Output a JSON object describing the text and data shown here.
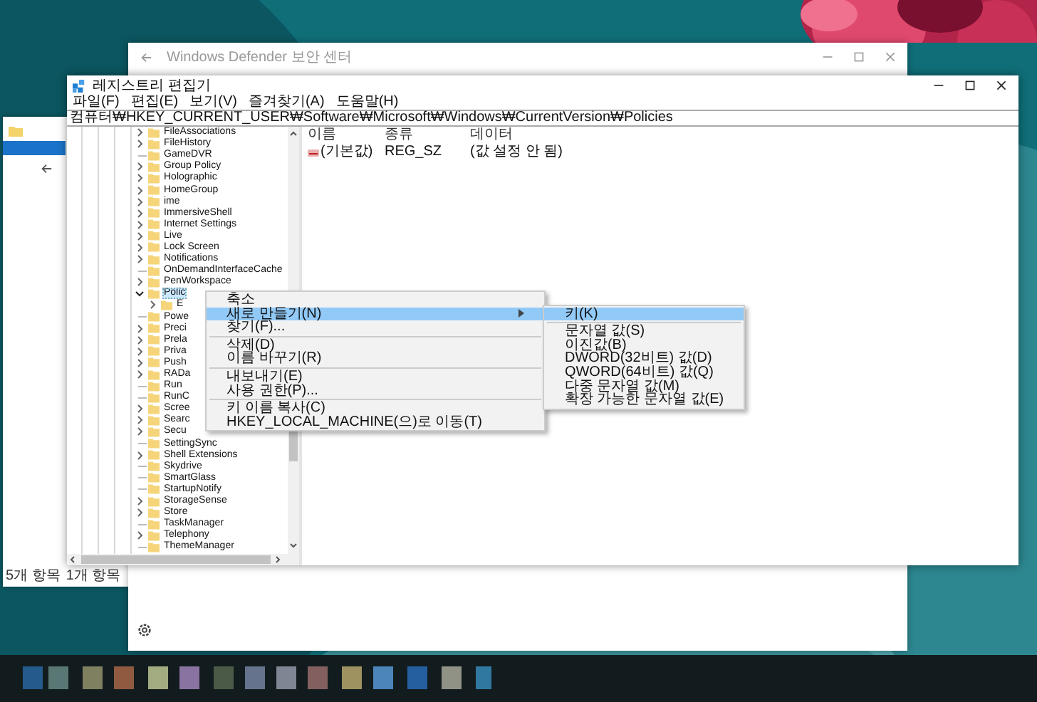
{
  "background_window": {
    "title": "Windows Defender 보안 센터"
  },
  "explorer_window": {
    "status_items": [
      "5개 항목",
      "1개 항목"
    ]
  },
  "registry_editor": {
    "title": "레지스트리 편집기",
    "menu": [
      "파일(F)",
      "편집(E)",
      "보기(V)",
      "즐겨찾기(A)",
      "도움말(H)"
    ],
    "address": "컴퓨터₩HKEY_CURRENT_USER₩Software₩Microsoft₩Windows₩CurrentVersion₩Policies",
    "tree": [
      {
        "label": "FileAssociations",
        "kind": "branch",
        "expanded": false,
        "selected": false
      },
      {
        "label": "FileHistory",
        "kind": "branch",
        "expanded": false,
        "selected": false
      },
      {
        "label": "GameDVR",
        "kind": "leaf",
        "selected": false
      },
      {
        "label": "Group Policy",
        "kind": "branch",
        "expanded": false,
        "selected": false
      },
      {
        "label": "Holographic",
        "kind": "branch",
        "expanded": false,
        "selected": false
      },
      {
        "label": "HomeGroup",
        "kind": "branch",
        "expanded": false,
        "selected": false
      },
      {
        "label": "ime",
        "kind": "branch",
        "expanded": false,
        "selected": false
      },
      {
        "label": "ImmersiveShell",
        "kind": "branch",
        "expanded": false,
        "selected": false
      },
      {
        "label": "Internet Settings",
        "kind": "branch",
        "expanded": false,
        "selected": false
      },
      {
        "label": "Live",
        "kind": "branch",
        "expanded": false,
        "selected": false
      },
      {
        "label": "Lock Screen",
        "kind": "branch",
        "expanded": false,
        "selected": false
      },
      {
        "label": "Notifications",
        "kind": "branch",
        "expanded": false,
        "selected": false
      },
      {
        "label": "OnDemandInterfaceCache",
        "kind": "leaf",
        "selected": false
      },
      {
        "label": "PenWorkspace",
        "kind": "branch",
        "expanded": false,
        "selected": false
      },
      {
        "label": "Polic",
        "kind": "branch",
        "expanded": true,
        "selected": true,
        "children": [
          {
            "label": "E",
            "kind": "branch",
            "expanded": false,
            "selected": false
          }
        ]
      },
      {
        "label": "Powe",
        "kind": "leaf",
        "selected": false
      },
      {
        "label": "Preci",
        "kind": "branch",
        "expanded": false,
        "selected": false
      },
      {
        "label": "Prela",
        "kind": "branch",
        "expanded": false,
        "selected": false
      },
      {
        "label": "Priva",
        "kind": "branch",
        "expanded": false,
        "selected": false
      },
      {
        "label": "Push",
        "kind": "branch",
        "expanded": false,
        "selected": false
      },
      {
        "label": "RADa",
        "kind": "branch",
        "expanded": false,
        "selected": false
      },
      {
        "label": "Run",
        "kind": "leaf",
        "selected": false
      },
      {
        "label": "RunC",
        "kind": "leaf",
        "selected": false
      },
      {
        "label": "Scree",
        "kind": "branch",
        "expanded": false,
        "selected": false
      },
      {
        "label": "Searc",
        "kind": "branch",
        "expanded": false,
        "selected": false
      },
      {
        "label": "Secu",
        "kind": "branch",
        "expanded": false,
        "selected": false
      },
      {
        "label": "SettingSync",
        "kind": "leaf",
        "selected": false
      },
      {
        "label": "Shell Extensions",
        "kind": "branch",
        "expanded": false,
        "selected": false
      },
      {
        "label": "Skydrive",
        "kind": "leaf",
        "selected": false
      },
      {
        "label": "SmartGlass",
        "kind": "leaf",
        "selected": false
      },
      {
        "label": "StartupNotify",
        "kind": "leaf",
        "selected": false
      },
      {
        "label": "StorageSense",
        "kind": "branch",
        "expanded": false,
        "selected": false
      },
      {
        "label": "Store",
        "kind": "branch",
        "expanded": false,
        "selected": false
      },
      {
        "label": "TaskManager",
        "kind": "leaf",
        "selected": false
      },
      {
        "label": "Telephony",
        "kind": "branch",
        "expanded": false,
        "selected": false
      },
      {
        "label": "ThemeManager",
        "kind": "leaf",
        "selected": false
      }
    ],
    "columns": [
      "이름",
      "종류",
      "데이터"
    ],
    "values": [
      {
        "name": "(기본값)",
        "type": "REG_SZ",
        "data": "(값 설정 안 됨)"
      }
    ]
  },
  "context_menu": {
    "items": [
      {
        "kind": "item",
        "label": "축소",
        "selected": false,
        "submenu": false
      },
      {
        "kind": "item",
        "label": "새로 만들기(N)",
        "selected": true,
        "submenu": true
      },
      {
        "kind": "item",
        "label": "찾기(F)...",
        "selected": false,
        "submenu": false
      },
      {
        "kind": "separator"
      },
      {
        "kind": "item",
        "label": "삭제(D)",
        "selected": false,
        "submenu": false
      },
      {
        "kind": "item",
        "label": "이름 바꾸기(R)",
        "selected": false,
        "submenu": false
      },
      {
        "kind": "separator"
      },
      {
        "kind": "item",
        "label": "내보내기(E)",
        "selected": false,
        "submenu": false
      },
      {
        "kind": "item",
        "label": "사용 권한(P)...",
        "selected": false,
        "submenu": false
      },
      {
        "kind": "separator"
      },
      {
        "kind": "item",
        "label": "키 이름 복사(C)",
        "selected": false,
        "submenu": false
      },
      {
        "kind": "item",
        "label": "HKEY_LOCAL_MACHINE(으)로 이동(T)",
        "selected": false,
        "submenu": false
      }
    ]
  },
  "submenu": {
    "items": [
      {
        "kind": "item",
        "label": "키(K)",
        "selected": true
      },
      {
        "kind": "separator"
      },
      {
        "kind": "item",
        "label": "문자열 값(S)",
        "selected": false
      },
      {
        "kind": "item",
        "label": "이진값(B)",
        "selected": false
      },
      {
        "kind": "item",
        "label": "DWORD(32비트) 값(D)",
        "selected": false
      },
      {
        "kind": "item",
        "label": "QWORD(64비트) 값(Q)",
        "selected": false
      },
      {
        "kind": "item",
        "label": "다중 문자열 값(M)",
        "selected": false
      },
      {
        "kind": "item",
        "label": "확장 가능한 문자열 값(E)",
        "selected": false
      }
    ]
  }
}
